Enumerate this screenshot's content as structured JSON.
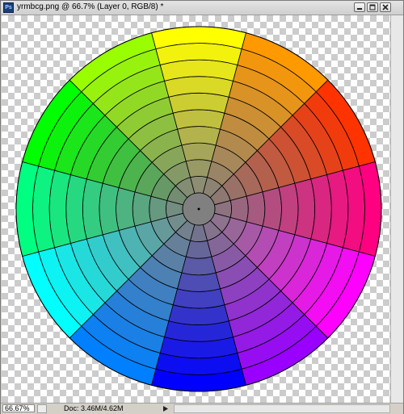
{
  "window": {
    "title": "yrmbcg.png @ 66.7% (Layer 0, RGB/8) *",
    "app_icon": "photoshop-icon",
    "buttons": [
      "minimize-icon",
      "maximize-icon",
      "close-icon"
    ]
  },
  "status": {
    "zoom": "66.67%",
    "doc": "Doc: 3.46M/4.62M"
  },
  "color_wheel": {
    "segments": 12,
    "rings": 10,
    "center_color": "#808080",
    "hues": [
      "#ffff00",
      "#ff9900",
      "#ff3300",
      "#ff0080",
      "#ff00ff",
      "#9900ff",
      "#0000ff",
      "#0080ff",
      "#00ffff",
      "#00ff80",
      "#00ff00",
      "#99ff00"
    ]
  }
}
